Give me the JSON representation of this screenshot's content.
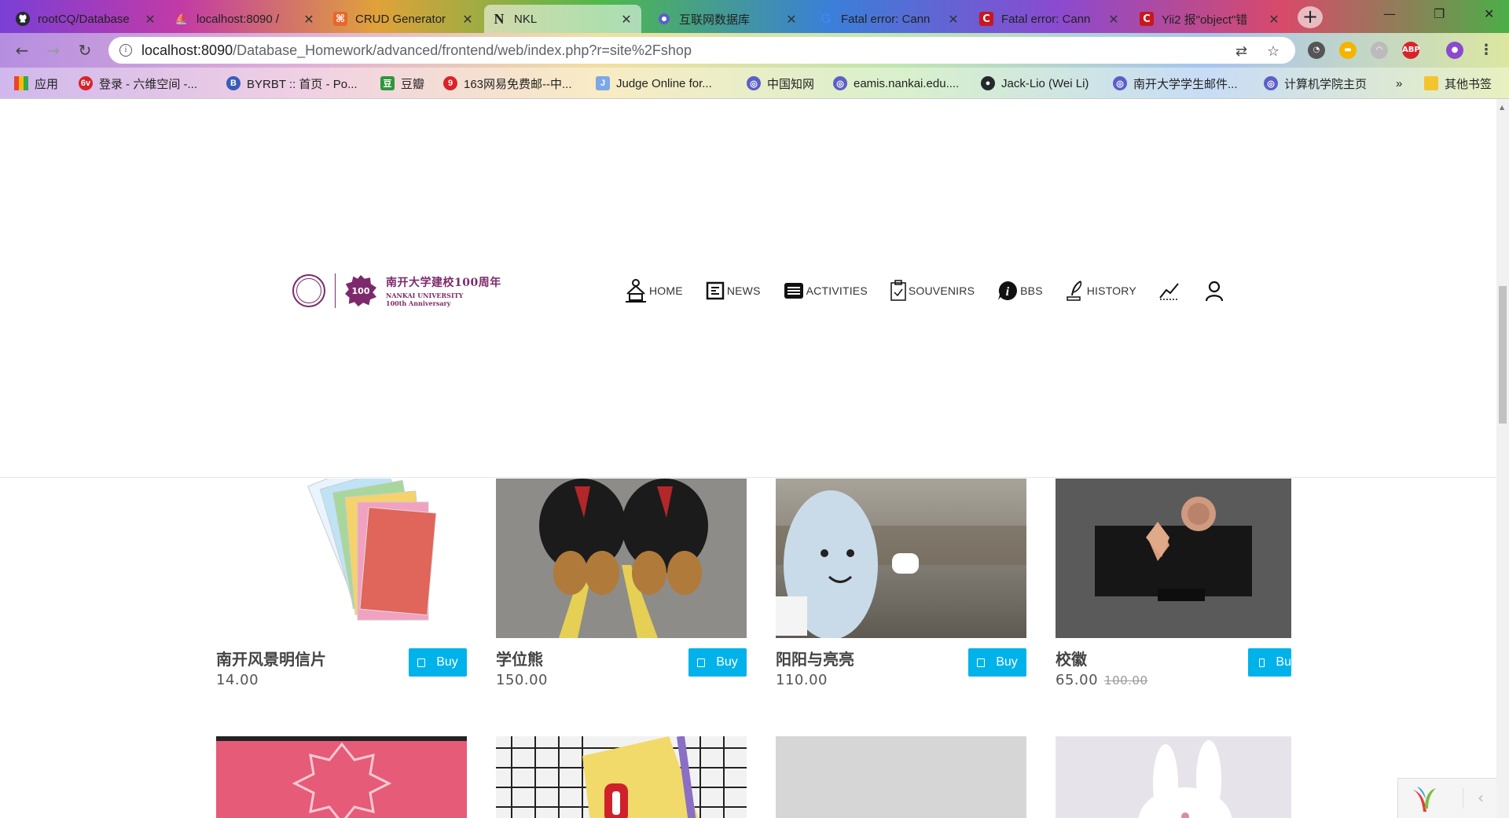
{
  "browser": {
    "tabs": [
      {
        "title": "rootCQ/Database",
        "icon": "github-icon",
        "color": "#24292e"
      },
      {
        "title": "localhost:8090 /",
        "icon": "phpmyadmin-icon",
        "color": "#6c78af"
      },
      {
        "title": "CRUD Generator",
        "icon": "yii-gii-icon",
        "color": "#e8672a"
      },
      {
        "title": "NKL",
        "icon": "n-letter-icon",
        "color": "#222222"
      },
      {
        "title": "互联网数据库",
        "icon": "globe-icon",
        "color": "#5b5fc7"
      },
      {
        "title": "Fatal error: Cann",
        "icon": "google-icon",
        "color": "#4285f4"
      },
      {
        "title": "Fatal error: Cann",
        "icon": "csdn-icon",
        "color": "#c9171e"
      },
      {
        "title": "Yii2 报\"object\"错",
        "icon": "csdn-icon",
        "color": "#c9171e"
      }
    ],
    "address": {
      "host": "localhost:8090",
      "path": "/Database_Homework/advanced/frontend/web/index.php?r=site%2Fshop"
    },
    "bookmarks": [
      {
        "label": "应用",
        "icon": "apps-grid-icon"
      },
      {
        "label": "登录 - 六维空间 -...",
        "icon": "6v-icon"
      },
      {
        "label": "BYRBT :: 首页 - Po...",
        "icon": "byrbt-icon"
      },
      {
        "label": "豆瓣",
        "icon": "douban-icon"
      },
      {
        "label": "163网易免费邮--中...",
        "icon": "163-mail-icon"
      },
      {
        "label": "Judge Online for...",
        "icon": "judge-icon"
      },
      {
        "label": "中国知网",
        "icon": "globe-icon"
      },
      {
        "label": "eamis.nankai.edu....",
        "icon": "globe-icon"
      },
      {
        "label": "Jack-Lio (Wei Li)",
        "icon": "github-icon"
      },
      {
        "label": "南开大学学生邮件...",
        "icon": "globe-icon"
      },
      {
        "label": "计算机学院主页",
        "icon": "globe-icon"
      }
    ],
    "bookmarks_more": "»",
    "other_bookmarks": "其他书签"
  },
  "site": {
    "logo": {
      "line1": "南开大学建校100周年",
      "line2": "NANKAI UNIVERSITY",
      "line3": "100th Anniversary",
      "badge": "100"
    },
    "nav": [
      {
        "label": "HOME",
        "icon": "home-icon"
      },
      {
        "label": "NEWS",
        "icon": "news-icon"
      },
      {
        "label": "ACTIVITIES",
        "icon": "activities-icon"
      },
      {
        "label": "SOUVENIRS",
        "icon": "souvenirs-icon"
      },
      {
        "label": "BBS",
        "icon": "info-icon"
      },
      {
        "label": "HISTORY",
        "icon": "history-icon"
      },
      {
        "label": "",
        "icon": "chart-icon"
      },
      {
        "label": "",
        "icon": "user-icon"
      }
    ]
  },
  "products": [
    {
      "name": "南开风景明信片",
      "price": "14.00",
      "old_price": "",
      "buy": "Buy",
      "image": "postcards"
    },
    {
      "name": "学位熊",
      "price": "150.00",
      "old_price": "",
      "buy": "Buy",
      "image": "bears"
    },
    {
      "name": "阳阳与亮亮",
      "price": "110.00",
      "old_price": "",
      "buy": "Buy",
      "image": "mascot"
    },
    {
      "name": "校徽",
      "price": "65.00",
      "old_price": "100.00",
      "buy": "Bu",
      "image": "badges"
    }
  ],
  "products_row2": [
    {
      "image": "red-100"
    },
    {
      "image": "notebook"
    },
    {
      "image": "grey"
    },
    {
      "image": "rabbit"
    }
  ],
  "colors": {
    "brand_purple": "#7d2a6c",
    "buy_button": "#00b2ea"
  }
}
